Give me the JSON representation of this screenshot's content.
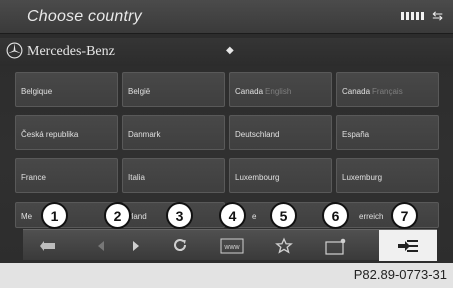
{
  "header": {
    "title": "Choose country",
    "signal_icon": "signal-bars-icon",
    "swap_icon": "swap-arrows-icon"
  },
  "brand": {
    "name": "Mercedes-Benz",
    "logo_icon": "mercedes-star-icon"
  },
  "countries": [
    {
      "name": "Belgique",
      "sub": ""
    },
    {
      "name": "België",
      "sub": ""
    },
    {
      "name": "Canada",
      "sub": "English"
    },
    {
      "name": "Canada",
      "sub": "Français"
    },
    {
      "name": "Česká republika",
      "sub": ""
    },
    {
      "name": "Danmark",
      "sub": ""
    },
    {
      "name": "Deutschland",
      "sub": ""
    },
    {
      "name": "España",
      "sub": ""
    },
    {
      "name": "France",
      "sub": ""
    },
    {
      "name": "Italia",
      "sub": ""
    },
    {
      "name": "Luxembourg",
      "sub": ""
    },
    {
      "name": "Luxemburg",
      "sub": ""
    }
  ],
  "partial_row": [
    {
      "name": "Me"
    },
    {
      "name": "derland"
    },
    {
      "name": "e"
    },
    {
      "name": "erreich"
    }
  ],
  "toolbar": {
    "items": [
      {
        "icon": "back-icon",
        "callout": "1"
      },
      {
        "icon": "previous-icon",
        "callout": "2"
      },
      {
        "icon": "refresh-icon",
        "callout": "3"
      },
      {
        "icon": "www-icon",
        "callout": "4"
      },
      {
        "icon": "favorites-star-icon",
        "callout": "5"
      },
      {
        "icon": "new-window-icon",
        "callout": "6"
      },
      {
        "icon": "menu-list-icon",
        "callout": "7"
      }
    ]
  },
  "caption": "P82.89-0773-31"
}
